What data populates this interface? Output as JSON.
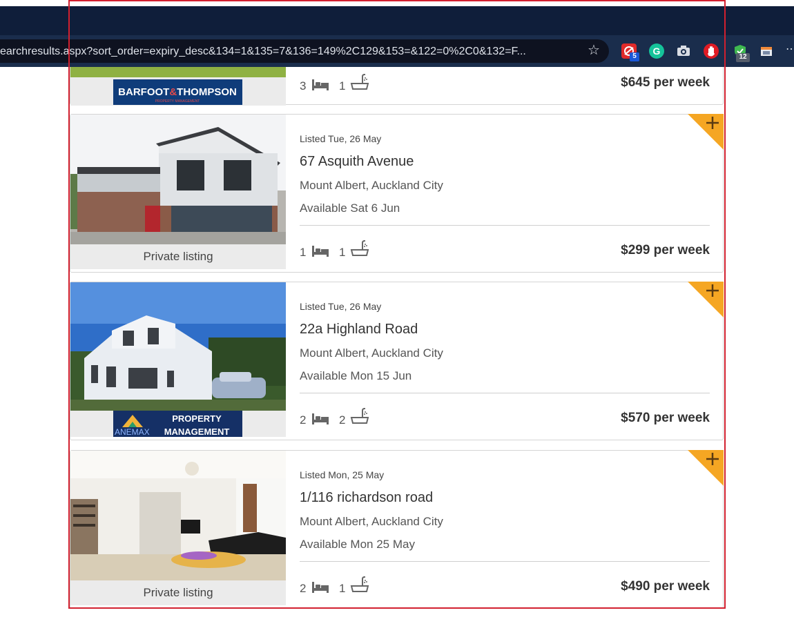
{
  "browser": {
    "url": "earchresults.aspx?sort_order=expiry_desc&134=1&135=7&136=149%2C129&153=&122=0%2C0&132=F...",
    "bookmark_icon": "star-icon",
    "extensions": [
      {
        "name": "red-extension-icon",
        "badge": "5"
      },
      {
        "name": "grammarly-icon",
        "badge": ""
      },
      {
        "name": "camera-icon",
        "badge": ""
      },
      {
        "name": "hand-stop-icon",
        "badge": ""
      },
      {
        "name": "shield-check-icon",
        "badge": "12"
      },
      {
        "name": "window-icon",
        "badge": ""
      }
    ]
  },
  "listings": [
    {
      "listed": "",
      "address": "",
      "suburb": "",
      "available": "",
      "agency": "BARFOOT & THOMPSON",
      "agency_sub": "PROPERTY MANAGEMENT",
      "beds": "3",
      "baths": "1",
      "price": "$645 per week"
    },
    {
      "listed": "Listed Tue, 26 May",
      "address": "67 Asquith Avenue",
      "suburb": "Mount Albert, Auckland City",
      "available": "Available Sat 6 Jun",
      "agency": "Private listing",
      "beds": "1",
      "baths": "1",
      "price": "$299 per week"
    },
    {
      "listed": "Listed Tue, 26 May",
      "address": "22a Highland Road",
      "suburb": "Mount Albert, Auckland City",
      "available": "Available Mon 15 Jun",
      "agency": "PROPERTY MANAGEMENT",
      "agency_mark": "ANEMAX",
      "beds": "2",
      "baths": "2",
      "price": "$570 per week"
    },
    {
      "listed": "Listed Mon, 25 May",
      "address": "1/116 richardson road",
      "suburb": "Mount Albert, Auckland City",
      "available": "Available Mon 25 May",
      "agency": "Private listing",
      "beds": "2",
      "baths": "1",
      "price": "$490 per week"
    }
  ],
  "colors": {
    "accent_corner": "#f5a623",
    "highlight_frame": "#d2202f",
    "barfoot_navy": "#0f3c7a",
    "anemax_navy": "#153066"
  }
}
